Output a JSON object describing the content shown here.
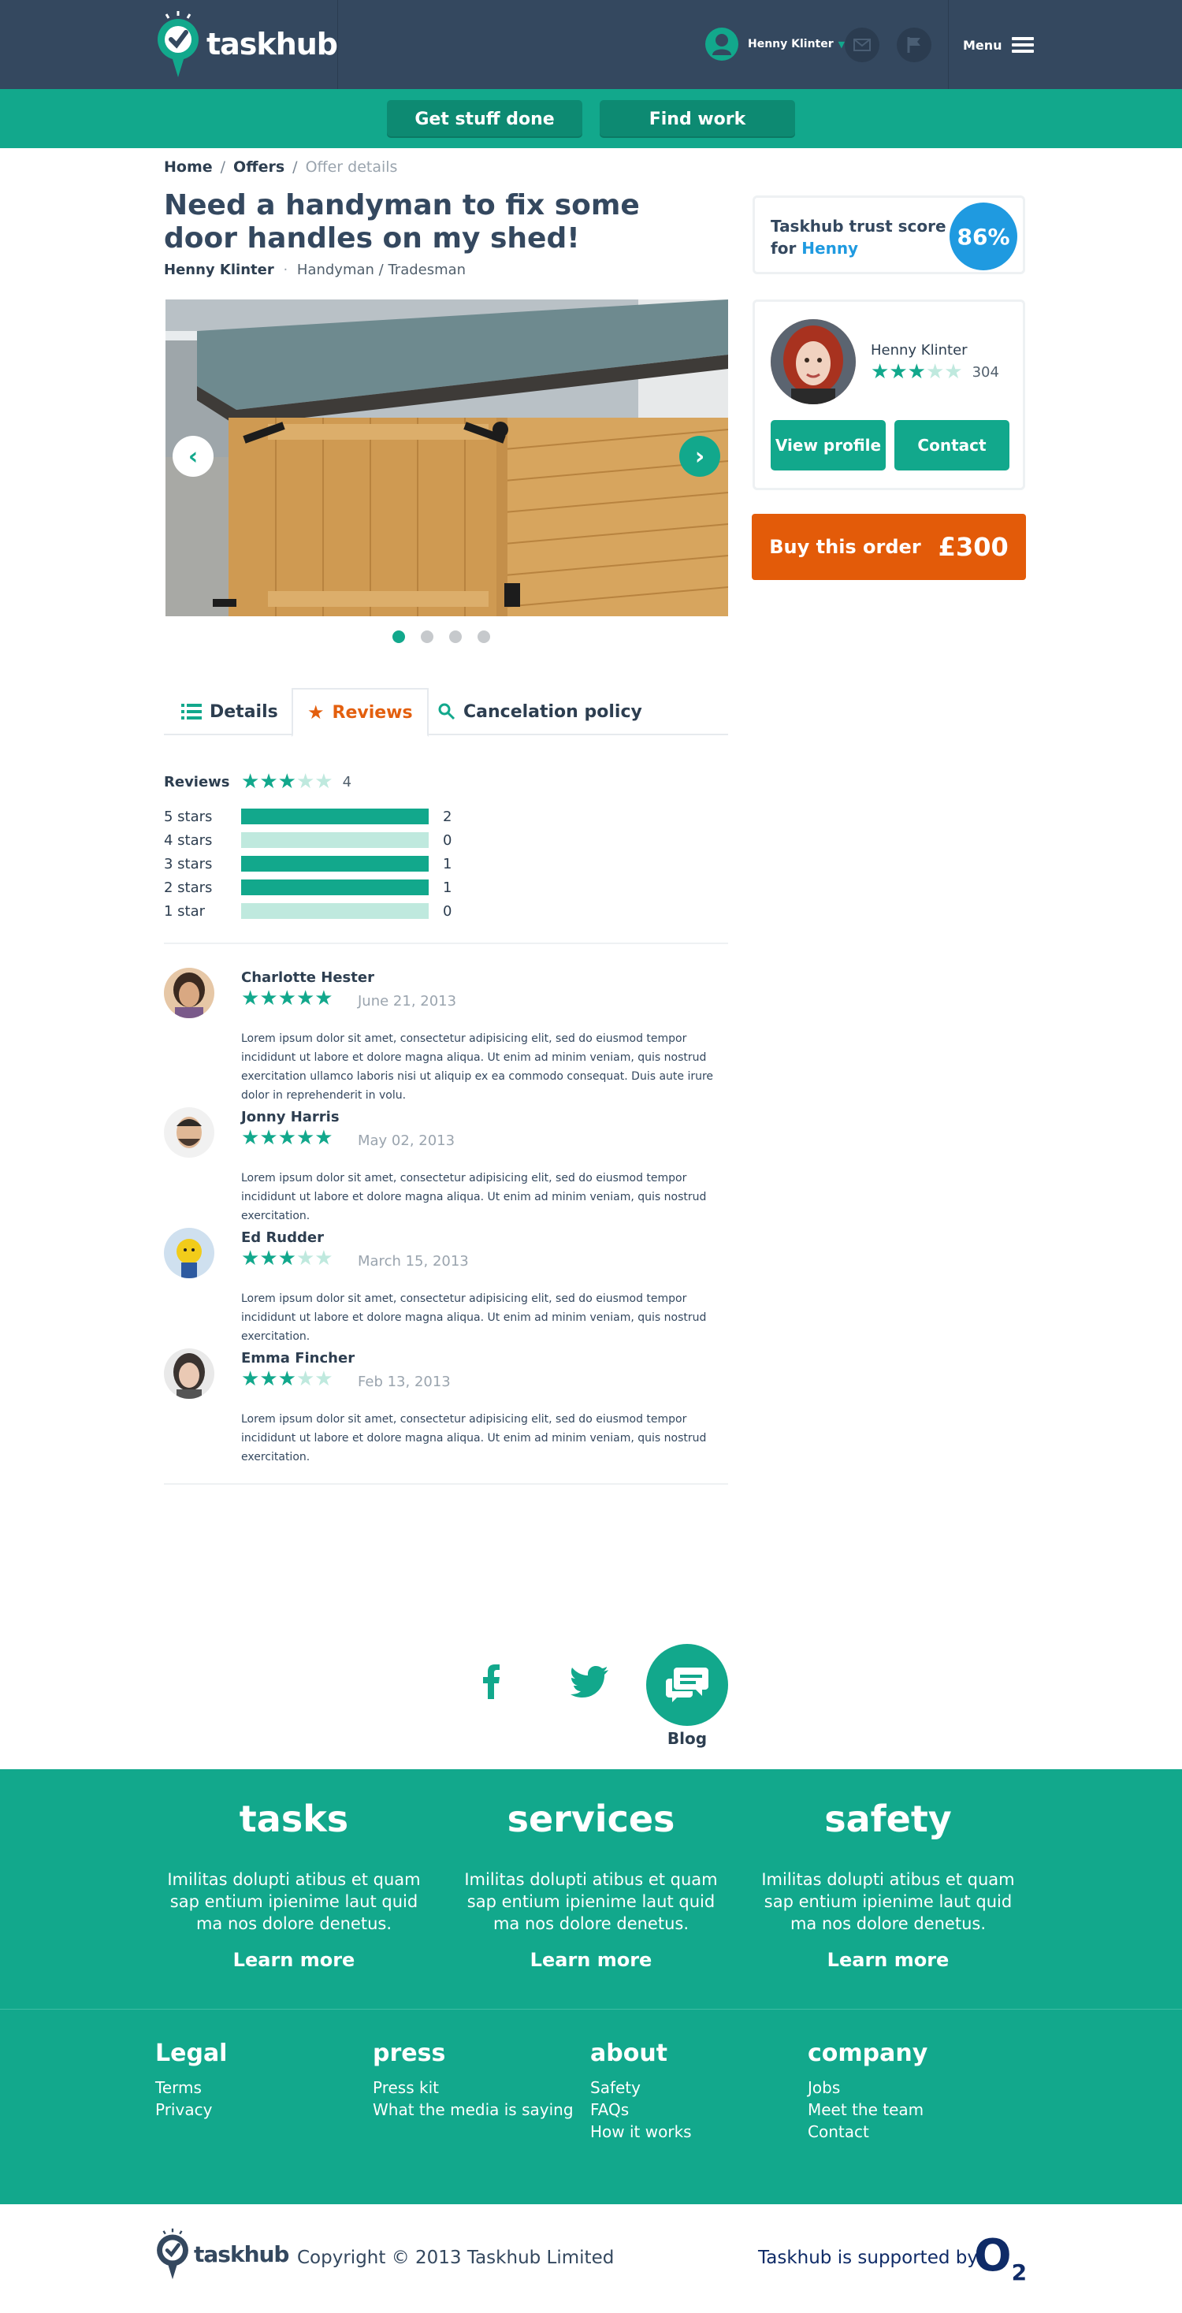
{
  "header": {
    "logo_text": "taskhub",
    "user_name": "Henny Klinter",
    "menu_label": "Menu"
  },
  "nav": {
    "get_stuff_done": "Get stuff done",
    "find_work": "Find work"
  },
  "breadcrumb": {
    "home": "Home",
    "offers": "Offers",
    "current": "Offer details",
    "separator": "/"
  },
  "offer": {
    "title": "Need a handyman to fix some door handles on my shed!",
    "author": "Henny Klinter",
    "category": "Handyman / Tradesman",
    "bullet": "·"
  },
  "gallery": {
    "slides": 4,
    "active_slide": 1
  },
  "tabs": {
    "details": "Details",
    "reviews": "Reviews",
    "cancellation": "Cancelation policy",
    "active": "reviews"
  },
  "reviews_summary": {
    "label": "Reviews",
    "rating": 3,
    "max": 5,
    "count": "4",
    "distribution": [
      {
        "label": "5 stars",
        "count": "2",
        "fraction": 1.0
      },
      {
        "label": "4 stars",
        "count": "0",
        "fraction": 0.0
      },
      {
        "label": "3 stars",
        "count": "1",
        "fraction": 1.0
      },
      {
        "label": "2 stars",
        "count": "1",
        "fraction": 1.0
      },
      {
        "label": "1 star",
        "count": "0",
        "fraction": 0.0
      }
    ]
  },
  "reviews": [
    {
      "name": "Charlotte Hester",
      "rating": 5,
      "date": "June 21, 2013",
      "text": "Lorem ipsum dolor sit amet, consectetur adipisicing elit, sed do eiusmod tempor incididunt ut labore et dolore magna aliqua. Ut enim ad minim veniam, quis nostrud exercitation ullamco laboris nisi ut aliquip ex ea commodo consequat. Duis aute irure dolor in reprehenderit in volu."
    },
    {
      "name": "Jonny Harris",
      "rating": 5,
      "date": "May 02, 2013",
      "text": "Lorem ipsum dolor sit amet, consectetur adipisicing elit, sed do eiusmod tempor incididunt ut labore et dolore magna aliqua. Ut enim ad minim veniam, quis nostrud exercitation."
    },
    {
      "name": "Ed Rudder",
      "rating": 3,
      "date": "March 15, 2013",
      "text": "Lorem ipsum dolor sit amet, consectetur adipisicing elit, sed do eiusmod tempor incididunt ut labore et dolore magna aliqua. Ut enim ad minim veniam, quis nostrud exercitation."
    },
    {
      "name": "Emma Fincher",
      "rating": 3,
      "date": "Feb 13, 2013",
      "text": "Lorem ipsum dolor sit amet, consectetur adipisicing elit, sed do eiusmod tempor incididunt ut labore et dolore magna aliqua. Ut enim ad minim veniam, quis nostrud exercitation."
    }
  ],
  "trust": {
    "line1": "Taskhub trust score",
    "for": "for",
    "name": "Henny",
    "score": "86%"
  },
  "profile": {
    "name": "Henny Klinter",
    "rating": 3,
    "count": "304",
    "view_profile": "View profile",
    "contact": "Contact"
  },
  "buy": {
    "label": "Buy this order",
    "price": "£300"
  },
  "social": {
    "blog_label": "Blog",
    "icons": [
      "facebook-icon",
      "twitter-icon",
      "chat-bubbles-icon"
    ]
  },
  "footer_features": [
    {
      "title": "tasks",
      "desc": "Imilitas dolupti atibus et quam sap entium ipienime laut quid ma nos dolore denetus.",
      "link": "Learn more"
    },
    {
      "title": "services",
      "desc": "Imilitas dolupti atibus et quam sap entium ipienime laut quid ma nos dolore denetus.",
      "link": "Learn more"
    },
    {
      "title": "safety",
      "desc": "Imilitas dolupti atibus et quam sap entium ipienime laut quid ma nos dolore denetus.",
      "link": "Learn more"
    }
  ],
  "footer_links": [
    {
      "title": "Legal",
      "items": [
        "Terms",
        "Privacy"
      ]
    },
    {
      "title": "press",
      "items": [
        "Press kit",
        "What the media is saying"
      ]
    },
    {
      "title": "about",
      "items": [
        "Safety",
        "FAQs",
        "How it works"
      ]
    },
    {
      "title": "company",
      "items": [
        "Jobs",
        "Meet the team",
        "Contact"
      ]
    }
  ],
  "bottom": {
    "logo_text": "taskhub",
    "copyright": "Copyright © 2013 Taskhub Limited",
    "supported": "Taskhub is supported by",
    "sponsor": "O",
    "sponsor_sub": "2"
  },
  "colors": {
    "header_bg": "#34485f",
    "accent_green": "#12a88c",
    "buy_orange": "#e35b09",
    "trust_blue": "#1f9ae0",
    "star_empty": "#bfe9de"
  }
}
